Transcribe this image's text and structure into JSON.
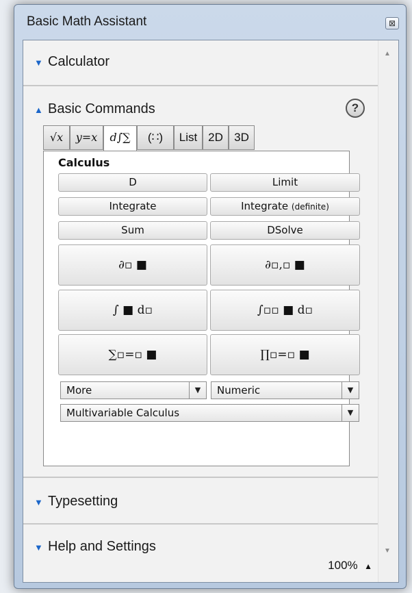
{
  "window": {
    "title": "Basic Math Assistant",
    "close_glyph": "⊠"
  },
  "sections": {
    "calculator": {
      "label": "Calculator",
      "state": "collapsed"
    },
    "basic_commands": {
      "label": "Basic Commands",
      "state": "expanded"
    },
    "typesetting": {
      "label": "Typesetting",
      "state": "collapsed"
    },
    "help_settings": {
      "label": "Help and Settings",
      "state": "collapsed"
    }
  },
  "icons": {
    "expand": "chevron-down-icon",
    "collapse": "chevron-up-icon",
    "help": "question-icon"
  },
  "help_glyph": "?",
  "tabs": [
    {
      "label": "√x",
      "active": false
    },
    {
      "label": "y=x",
      "active": false
    },
    {
      "label": "d∫∑",
      "active": true
    },
    {
      "label": "(∷)",
      "active": false
    },
    {
      "label": "List",
      "active": false
    },
    {
      "label": "2D",
      "active": false
    },
    {
      "label": "3D",
      "active": false
    }
  ],
  "panel": {
    "title": "Calculus",
    "buttons": {
      "d": "D",
      "limit": "Limit",
      "integrate": "Integrate",
      "integrate_def": "Integrate",
      "integrate_def_sub": "(definite)",
      "sum": "Sum",
      "dsolve": "DSolve",
      "partial": "∂▫ ■",
      "partial_multi": "∂▫,▫ ■",
      "indef_integral": "∫ ■ d▫",
      "def_integral": "∫▫▫ ■ d▫",
      "summation": "∑▫=▫ ■",
      "product": "∏▫=▫ ■"
    },
    "dropdowns": {
      "more": "More",
      "numeric": "Numeric",
      "multivariable": "Multivariable Calculus"
    }
  },
  "zoom": "100%"
}
